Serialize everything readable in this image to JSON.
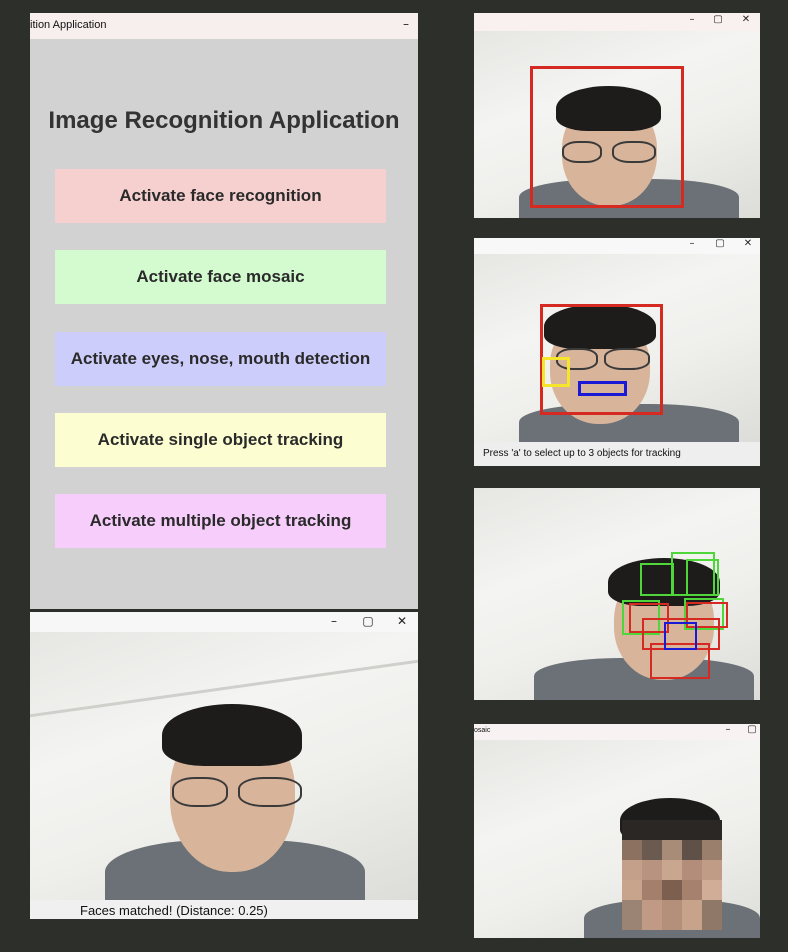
{
  "app_window": {
    "title": "ition Application",
    "minimize": "–",
    "heading": "Image Recognition Application",
    "buttons": [
      {
        "label": "Activate face recognition",
        "color": "#f6cfcf"
      },
      {
        "label": "Activate face mosaic",
        "color": "#d4fbd0"
      },
      {
        "label": "Activate eyes, nose, mouth detection",
        "color": "#cdcdfb"
      },
      {
        "label": "Activate single object tracking",
        "color": "#fdfdd2"
      },
      {
        "label": "Activate multiple object tracking",
        "color": "#f6cdfb"
      }
    ]
  },
  "recognition_window": {
    "controls": {
      "minimize": "–",
      "maximize": "▢",
      "close": "✕"
    },
    "status": "Faces matched! (Distance: 0.25)"
  },
  "detection_window_1": {
    "controls": {
      "minimize": "–",
      "maximize": "▢",
      "close": "✕"
    },
    "box_color": "#d42a22"
  },
  "feature_window": {
    "controls": {
      "minimize": "–",
      "maximize": "▢",
      "close": "✕"
    },
    "status": "Press 'a' to select up to 3 objects for tracking",
    "colors": {
      "face": "#d42a22",
      "eye": "#f5e52c",
      "mouth": "#1a1ad6"
    }
  },
  "tracking_window": {
    "colors": {
      "green": "#4ed63a",
      "red": "#d42a22",
      "blue": "#1a1ad6"
    }
  },
  "mosaic_window": {
    "title": "osaic",
    "controls": {
      "minimize": "–",
      "maximize": "▢"
    }
  }
}
